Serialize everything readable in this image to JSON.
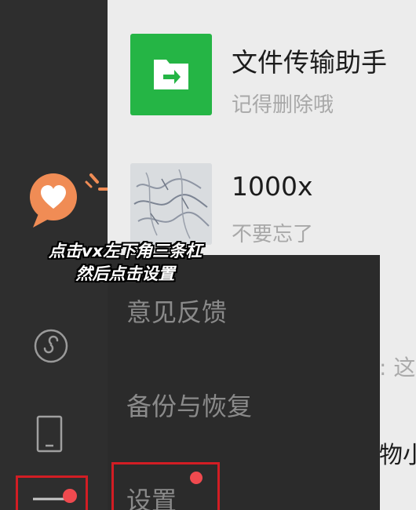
{
  "chats": [
    {
      "name": "文件传输助手",
      "preview": "记得删除哦",
      "avatar_icon": "folder-arrow-icon"
    },
    {
      "name": "1000x",
      "preview": "不要忘了",
      "avatar_icon": "sketch-avatar"
    }
  ],
  "partial_texts": {
    "colon_fragment": ": 这",
    "item_fragment": "物小"
  },
  "menu": {
    "items": [
      "意见反馈",
      "备份与恢复",
      "设置"
    ]
  },
  "caption": {
    "line1": "点击vx左下角三条杠",
    "line2": "然后点击设置"
  },
  "colors": {
    "highlight_border": "#d21d24",
    "notification_dot": "#f04a4f",
    "sticker": "#f08c55",
    "file_transfer_green": "#25b545"
  }
}
